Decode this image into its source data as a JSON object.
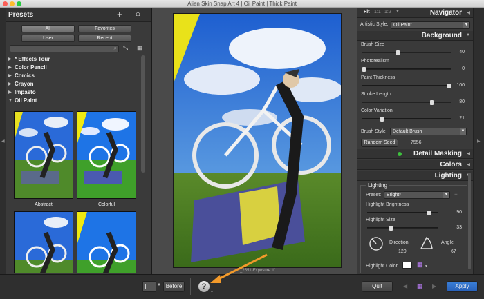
{
  "window": {
    "title": "Alien Skin Snap Art 4 | Oil Paint | Thick Paint"
  },
  "presets": {
    "header": "Presets",
    "filters": [
      "All",
      "Favorites",
      "User",
      "Recent"
    ],
    "search_placeholder": "",
    "categories": [
      "* Effects Tour",
      "Color Pencil",
      "Comics",
      "Crayon",
      "Impasto",
      "Oil Paint"
    ],
    "thumbnails": [
      "Abstract",
      "Colorful"
    ]
  },
  "preview": {
    "filename": "_2551-Exposure.tif"
  },
  "navigator": {
    "fit": "Fit",
    "one_one": "1:1",
    "one_two": "1:2",
    "title": "Navigator"
  },
  "artistic_style": {
    "label": "Artistic Style:",
    "value": "Oil Paint"
  },
  "background": {
    "title": "Background",
    "sliders": [
      {
        "label": "Brush Size",
        "value": "40",
        "fraction": 0.4
      },
      {
        "label": "Photorealism",
        "value": "0",
        "fraction": 0.0
      },
      {
        "label": "Paint Thickness",
        "value": "100",
        "fraction": 1.0
      },
      {
        "label": "Stroke Length",
        "value": "80",
        "fraction": 0.8
      },
      {
        "label": "Color Variation",
        "value": "21",
        "fraction": 0.21
      }
    ],
    "brush_style_label": "Brush Style",
    "brush_style_value": "Default Brush",
    "random_seed_label": "Random Seed",
    "random_seed_value": "7556"
  },
  "sections": {
    "detail_masking": "Detail Masking",
    "colors": "Colors",
    "lighting": "Lighting"
  },
  "lighting": {
    "group_title": "Lighting",
    "preset_label": "Preset:",
    "preset_value": "Bright*",
    "sliders": [
      {
        "label": "Highlight Brightness",
        "value": "90",
        "fraction": 0.9
      },
      {
        "label": "Highlight Size",
        "value": "33",
        "fraction": 0.33
      }
    ],
    "direction_label": "Direction",
    "direction_value": "120",
    "angle_label": "Angle",
    "angle_value": "67",
    "highlight_color_label": "Highlight Color"
  },
  "bottom": {
    "before": "Before",
    "quit": "Quit",
    "apply": "Apply"
  },
  "colors": {
    "accent": "#2f6fce",
    "panel": "#3a3a3a",
    "green_dot": "#3ec13e",
    "arrow": "#f39a2a"
  }
}
